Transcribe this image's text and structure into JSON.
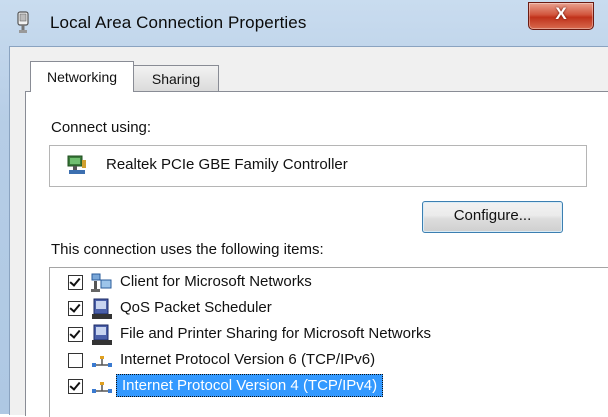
{
  "window": {
    "title": "Local Area Connection Properties",
    "close_label": "X"
  },
  "tabs": [
    {
      "label": "Networking",
      "active": true
    },
    {
      "label": "Sharing",
      "active": false
    }
  ],
  "connect_using": {
    "label": "Connect using:",
    "adapter": "Realtek PCIe GBE Family Controller"
  },
  "configure_button": "Configure...",
  "items_label": "This connection uses the following items:",
  "items": [
    {
      "label": "Client for Microsoft Networks",
      "checked": true,
      "icon": "network-client-icon"
    },
    {
      "label": "QoS Packet Scheduler",
      "checked": true,
      "icon": "service-icon"
    },
    {
      "label": "File and Printer Sharing for Microsoft Networks",
      "checked": true,
      "icon": "service-icon"
    },
    {
      "label": "Internet Protocol Version 6 (TCP/IPv6)",
      "checked": false,
      "icon": "protocol-icon"
    },
    {
      "label": "Internet Protocol Version 4 (TCP/IPv4)",
      "checked": true,
      "icon": "protocol-icon",
      "selected": true
    }
  ],
  "colors": {
    "selection": "#3399ff",
    "close_button": "#c0321b"
  }
}
